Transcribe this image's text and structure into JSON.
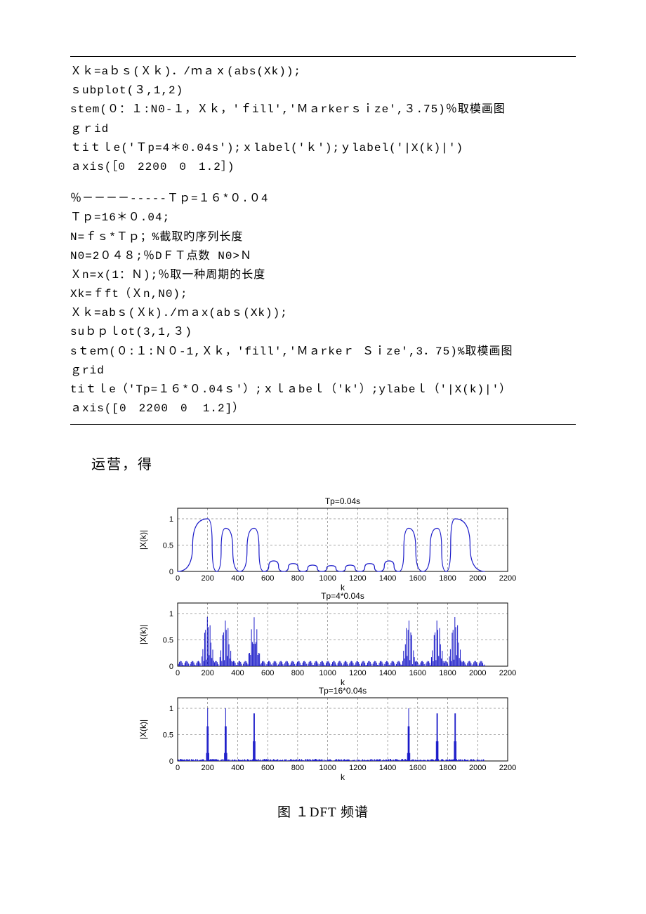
{
  "code_lines": [
    "Ｘｋ=aｂｓ(Ｘｋ)．/ｍａｘ(abs(Xk));",
    "ｓubplot(３,1,2)",
    "stem(０：１:N0-１，Ｘｋ，'ｆill','Ｍａrkerｓｉze',３.75)％取模画图",
    "ｇｒid",
    "ｔiｔｌe('Ｔp=4＊0.04s');ｘlabel('ｋ');ｙlabel('|X(k)|')",
    "ａxis(［0　2200　0　1.2］)",
    "",
    "％－－－－-----Ｔｐ=１６*０.０4",
    "Ｔｐ=16＊０.04;",
    "N=ｆｓ*Ｔｐ；%截取旳序列长度",
    "N0=2０４８;％DＦＴ点数 N0>Ｎ",
    "Ｘn=x(1：Ｎ);％取一种周期的长度",
    "Xk=ｆft（Ｘn,N0);",
    "Ｘｋ=abｓ(Ｘk)./ｍａx(abｓ(Xk));",
    "suｂｐｌot(3,1,３)",
    "sｔeｍ(０:１:Ｎ０-1,Ｘｋ，'fill','Ｍａrkeｒ Ｓｉze',3．75)%取模画图",
    "ｇrid",
    "tiｔｌe（'Tp=１６*０.04ｓ'）;ｘｌａbeｌ（'k'）;ylabeｌ（'|X(k)|'）",
    "ａxis([0　2200　0  1.2]）"
  ],
  "paragraph": "运营，得",
  "caption": "图 １DFT 频谱",
  "chart_data": [
    {
      "type": "line",
      "title": "Tp=0.04s",
      "xlabel": "k",
      "ylabel": "|X(k)|",
      "xlim": [
        0,
        2200
      ],
      "ylim": [
        0,
        1.2
      ],
      "xticks": [
        0,
        200,
        400,
        600,
        800,
        1000,
        1200,
        1400,
        1600,
        1800,
        2000,
        2200
      ],
      "yticks": [
        0,
        0.5,
        1
      ],
      "grid": true,
      "peaks": [
        {
          "x": 200,
          "y": 1.0
        },
        {
          "x": 320,
          "y": 0.82
        },
        {
          "x": 510,
          "y": 0.82
        },
        {
          "x": 640,
          "y": 0.2
        },
        {
          "x": 770,
          "y": 0.15
        },
        {
          "x": 900,
          "y": 0.12
        },
        {
          "x": 1024,
          "y": 0.11
        },
        {
          "x": 1150,
          "y": 0.12
        },
        {
          "x": 1280,
          "y": 0.15
        },
        {
          "x": 1410,
          "y": 0.2
        },
        {
          "x": 1540,
          "y": 0.82
        },
        {
          "x": 1730,
          "y": 0.82
        },
        {
          "x": 1850,
          "y": 1.0
        }
      ]
    },
    {
      "type": "stem",
      "title": "Tp=4*0.04s",
      "xlabel": "k",
      "ylabel": "|X(k)|",
      "xlim": [
        0,
        2200
      ],
      "ylim": [
        0,
        1.2
      ],
      "xticks": [
        0,
        200,
        400,
        600,
        800,
        1000,
        1200,
        1400,
        1600,
        1800,
        2000,
        2200
      ],
      "yticks": [
        0,
        0.5,
        1
      ],
      "grid": true,
      "clusters": [
        {
          "center": 200,
          "peak": 1.0
        },
        {
          "center": 320,
          "peak": 0.93
        },
        {
          "center": 510,
          "peak": 0.93
        },
        {
          "center": 1540,
          "peak": 0.93
        },
        {
          "center": 1730,
          "peak": 0.93
        },
        {
          "center": 1850,
          "peak": 1.0
        }
      ],
      "low_level": 0.1
    },
    {
      "type": "stem",
      "title": "Tp=16*0.04s",
      "xlabel": "k",
      "ylabel": "|X(k)|",
      "xlim": [
        0,
        2200
      ],
      "ylim": [
        0,
        1.2
      ],
      "xticks": [
        0,
        200,
        400,
        600,
        800,
        1000,
        1200,
        1400,
        1600,
        1800,
        2000,
        2200
      ],
      "yticks": [
        0,
        0.5,
        1
      ],
      "grid": true,
      "spikes": [
        200,
        320,
        510,
        1540,
        1730,
        1850
      ],
      "spike_height": 1.0,
      "noise_level": 0.04
    }
  ],
  "axis": {
    "xticks": [
      "0",
      "200",
      "400",
      "600",
      "800",
      "1000",
      "1200",
      "1400",
      "1600",
      "1800",
      "2000",
      "2200"
    ],
    "yticks": [
      "0",
      "0.5",
      "1"
    ]
  },
  "titles": {
    "t1": "Tp=0.04s",
    "t2": "Tp=4*0.04s",
    "t3": "Tp=16*0.04s",
    "xl": "k",
    "yl": "|X(k)|"
  }
}
